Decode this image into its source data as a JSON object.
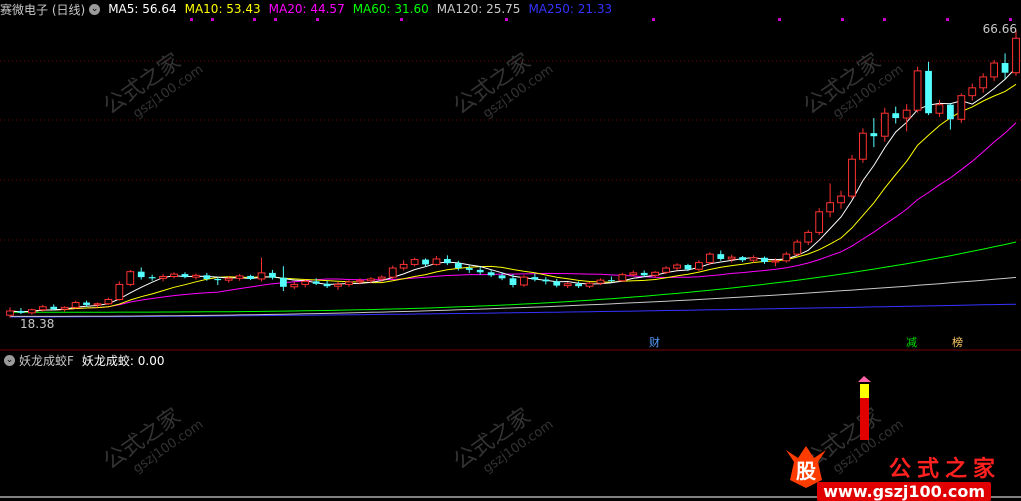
{
  "main_legend": {
    "title": "赛微电子 (日线)",
    "ma5": "MA5: 56.64",
    "ma10": "MA10: 53.43",
    "ma20": "MA20: 44.57",
    "ma60": "MA60: 31.60",
    "ma120": "MA120: 25.75",
    "ma250": "MA250: 21.33"
  },
  "colors": {
    "ma5": "#ffffff",
    "ma10": "#ffff00",
    "ma20": "#ff00ff",
    "ma60": "#00ff00",
    "ma120": "#c8c8c8",
    "ma250": "#3333ff",
    "up": "#ff3232",
    "down": "#54ffff",
    "grid": "#7a0000"
  },
  "price_labels": {
    "high": "66.66",
    "low": "18.38"
  },
  "markers": {
    "m1": "财",
    "m2": "减",
    "m3": "榜"
  },
  "sub_legend": {
    "title": "妖龙成蛟F",
    "value": "妖龙成蛟: 0.00"
  },
  "watermark": {
    "text": "公式之家",
    "url": "gszj100.com"
  },
  "logo": {
    "text": "公式之家",
    "url": "www.gszj100.com"
  },
  "chart_data": {
    "type": "candlestick",
    "ylim": [
      18.38,
      66.66
    ],
    "candles": [
      [
        19.5,
        20.8,
        19.1,
        20.2
      ],
      [
        20.2,
        20.7,
        19.7,
        19.9
      ],
      [
        19.9,
        20.6,
        19.6,
        20.4
      ],
      [
        20.4,
        21.2,
        20.1,
        20.9
      ],
      [
        20.9,
        21.3,
        20.3,
        20.5
      ],
      [
        20.5,
        21.0,
        20.1,
        20.8
      ],
      [
        20.8,
        21.9,
        20.6,
        21.6
      ],
      [
        21.6,
        21.9,
        20.9,
        21.2
      ],
      [
        21.2,
        21.6,
        20.8,
        21.4
      ],
      [
        21.4,
        22.4,
        21.2,
        22.1
      ],
      [
        22.1,
        25.1,
        21.9,
        24.6
      ],
      [
        24.6,
        27.0,
        24.3,
        26.7
      ],
      [
        26.7,
        27.4,
        25.4,
        25.8
      ],
      [
        25.8,
        26.2,
        25.2,
        25.6
      ],
      [
        25.6,
        26.3,
        25.1,
        25.9
      ],
      [
        25.9,
        26.6,
        25.6,
        26.3
      ],
      [
        26.3,
        26.6,
        25.6,
        25.8
      ],
      [
        25.8,
        26.4,
        25.4,
        26.1
      ],
      [
        26.1,
        26.5,
        25.2,
        25.5
      ],
      [
        25.5,
        25.8,
        24.5,
        25.3
      ],
      [
        25.3,
        25.9,
        24.9,
        25.6
      ],
      [
        25.6,
        26.3,
        25.2,
        26.0
      ],
      [
        26.0,
        26.2,
        25.3,
        25.5
      ],
      [
        25.5,
        29.0,
        25.1,
        26.5
      ],
      [
        26.5,
        27.0,
        25.4,
        25.7
      ],
      [
        25.7,
        27.6,
        23.5,
        24.2
      ],
      [
        24.2,
        25.0,
        23.8,
        24.6
      ],
      [
        24.6,
        25.4,
        24.1,
        25.1
      ],
      [
        25.1,
        25.6,
        24.5,
        24.7
      ],
      [
        24.7,
        25.2,
        24.0,
        24.3
      ],
      [
        24.3,
        25.0,
        23.7,
        24.6
      ],
      [
        24.6,
        25.3,
        24.2,
        25.0
      ],
      [
        25.0,
        25.6,
        24.6,
        25.2
      ],
      [
        25.2,
        25.8,
        24.8,
        25.5
      ],
      [
        25.5,
        26.1,
        25.0,
        25.8
      ],
      [
        25.8,
        27.7,
        25.5,
        27.3
      ],
      [
        27.3,
        28.6,
        26.9,
        27.9
      ],
      [
        27.9,
        29.0,
        27.6,
        28.7
      ],
      [
        28.7,
        28.9,
        27.6,
        27.9
      ],
      [
        27.9,
        29.3,
        27.7,
        28.8
      ],
      [
        28.8,
        29.4,
        27.8,
        28.1
      ],
      [
        28.1,
        28.5,
        26.9,
        27.3
      ],
      [
        27.3,
        27.7,
        26.5,
        27.0
      ],
      [
        27.0,
        27.5,
        26.2,
        26.6
      ],
      [
        26.6,
        27.0,
        25.8,
        26.1
      ],
      [
        26.1,
        26.6,
        25.3,
        25.6
      ],
      [
        25.6,
        26.3,
        24.1,
        24.5
      ],
      [
        24.5,
        26.1,
        24.2,
        25.8
      ],
      [
        25.8,
        26.4,
        25.1,
        25.4
      ],
      [
        25.4,
        25.8,
        24.6,
        25.1
      ],
      [
        25.1,
        25.5,
        24.1,
        24.4
      ],
      [
        24.4,
        25.0,
        24.0,
        24.7
      ],
      [
        24.7,
        25.1,
        24.0,
        24.3
      ],
      [
        24.3,
        25.0,
        24.0,
        24.8
      ],
      [
        24.8,
        25.6,
        24.5,
        25.3
      ],
      [
        25.3,
        25.9,
        24.9,
        25.2
      ],
      [
        25.2,
        26.5,
        25.0,
        26.2
      ],
      [
        26.2,
        26.9,
        25.9,
        26.5
      ],
      [
        26.5,
        26.9,
        25.8,
        26.1
      ],
      [
        26.1,
        26.8,
        25.7,
        26.6
      ],
      [
        26.6,
        27.6,
        26.3,
        27.3
      ],
      [
        27.3,
        28.1,
        26.9,
        27.8
      ],
      [
        27.8,
        28.0,
        26.8,
        27.1
      ],
      [
        27.1,
        28.6,
        26.8,
        28.2
      ],
      [
        28.2,
        29.9,
        27.8,
        29.6
      ],
      [
        29.6,
        30.2,
        28.5,
        28.8
      ],
      [
        28.8,
        29.5,
        28.2,
        29.1
      ],
      [
        29.1,
        29.3,
        28.3,
        28.6
      ],
      [
        28.6,
        29.4,
        28.2,
        29.0
      ],
      [
        29.0,
        29.2,
        28.0,
        28.3
      ],
      [
        28.3,
        28.9,
        27.6,
        28.5
      ],
      [
        28.5,
        30.0,
        28.2,
        29.6
      ],
      [
        29.6,
        32.0,
        29.3,
        31.6
      ],
      [
        31.6,
        33.6,
        31.1,
        33.2
      ],
      [
        33.2,
        37.2,
        32.8,
        36.6
      ],
      [
        36.6,
        41.3,
        35.7,
        38.1
      ],
      [
        38.1,
        40.1,
        37.1,
        39.2
      ],
      [
        39.2,
        46.0,
        38.8,
        45.3
      ],
      [
        45.3,
        50.4,
        44.7,
        49.6
      ],
      [
        49.6,
        52.1,
        47.3,
        49.1
      ],
      [
        49.1,
        53.8,
        48.2,
        52.9
      ],
      [
        52.9,
        54.0,
        51.2,
        52.1
      ],
      [
        52.1,
        54.4,
        49.9,
        53.4
      ],
      [
        53.4,
        60.6,
        53.0,
        59.9
      ],
      [
        59.9,
        61.4,
        52.6,
        52.9
      ],
      [
        52.9,
        55.1,
        52.3,
        54.3
      ],
      [
        54.3,
        54.6,
        50.2,
        51.9
      ],
      [
        51.9,
        56.2,
        51.3,
        55.8
      ],
      [
        55.8,
        57.8,
        55.0,
        57.1
      ],
      [
        57.1,
        59.5,
        56.3,
        58.9
      ],
      [
        58.9,
        61.7,
        58.2,
        61.2
      ],
      [
        61.2,
        62.8,
        58.6,
        59.6
      ],
      [
        59.6,
        66.66,
        59.1,
        65.3
      ]
    ]
  }
}
